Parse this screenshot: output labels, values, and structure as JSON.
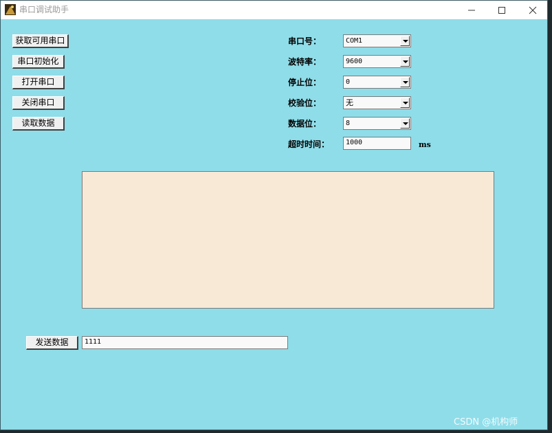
{
  "window": {
    "title": "串口调试助手"
  },
  "buttons": {
    "get_ports": "获取可用串口",
    "init_port": "串口初始化",
    "open_port": "打开串口",
    "close_port": "关闭串口",
    "read_data": "读取数据",
    "send_data": "发送数据"
  },
  "settings": {
    "port": {
      "label": "串口号：",
      "value": "COM1"
    },
    "baud": {
      "label": "波特率：",
      "value": "9600"
    },
    "stop": {
      "label": "停止位：",
      "value": "0"
    },
    "parity": {
      "label": "校验位：",
      "value": "无"
    },
    "databits": {
      "label": "数据位：",
      "value": "8"
    },
    "timeout": {
      "label": "超时时间：",
      "value": "1000",
      "unit": "ms"
    }
  },
  "output": {
    "text": ""
  },
  "send": {
    "value": "1111"
  },
  "watermark": "CSDN @机构师",
  "colors": {
    "window_bg": "#8fdde9",
    "output_bg": "#f8e9d7"
  }
}
